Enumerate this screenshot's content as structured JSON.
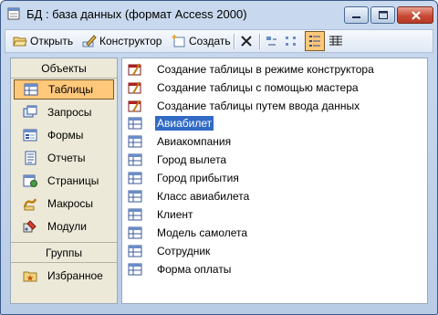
{
  "window": {
    "title": "БД : база данных (формат Access 2000)"
  },
  "toolbar": {
    "open_label": "Открыть",
    "open_underline": "О",
    "design_label": "Конструктор",
    "create_label": "Создать"
  },
  "sidebar": {
    "objects_header": "Объекты",
    "items": [
      {
        "label": "Таблицы",
        "icon": "table-icon",
        "selected": true
      },
      {
        "label": "Запросы",
        "icon": "query-icon"
      },
      {
        "label": "Формы",
        "icon": "form-icon"
      },
      {
        "label": "Отчеты",
        "icon": "report-icon"
      },
      {
        "label": "Страницы",
        "icon": "page-icon"
      },
      {
        "label": "Макросы",
        "icon": "macro-icon"
      },
      {
        "label": "Модули",
        "icon": "module-icon"
      }
    ],
    "groups_header": "Группы",
    "favorites_label": "Избранное"
  },
  "list": {
    "items": [
      {
        "label": "Создание таблицы в режиме конструктора",
        "icon": "wizard-icon"
      },
      {
        "label": "Создание таблицы с помощью мастера",
        "icon": "wizard-icon"
      },
      {
        "label": "Создание таблицы путем ввода данных",
        "icon": "wizard-icon"
      },
      {
        "label": "Авиабилет",
        "icon": "table-icon",
        "selected": true
      },
      {
        "label": "Авиакомпания",
        "icon": "table-icon"
      },
      {
        "label": "Город вылета",
        "icon": "table-icon"
      },
      {
        "label": "Город прибытия",
        "icon": "table-icon"
      },
      {
        "label": "Класс авиабилета",
        "icon": "table-icon"
      },
      {
        "label": "Клиент",
        "icon": "table-icon"
      },
      {
        "label": "Модель самолета",
        "icon": "table-icon"
      },
      {
        "label": "Сотрудник",
        "icon": "table-icon"
      },
      {
        "label": "Форма оплаты",
        "icon": "table-icon"
      }
    ]
  },
  "colors": {
    "selection": "#316ac5",
    "sidebar_selected": "#ffc87a",
    "titlebar": "#c9d9ee"
  }
}
